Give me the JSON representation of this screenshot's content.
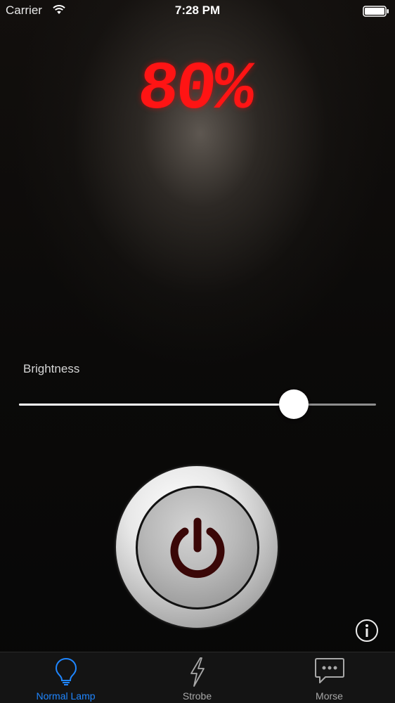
{
  "status_bar": {
    "carrier": "Carrier",
    "time": "7:28 PM",
    "wifi_icon": "wifi-icon",
    "battery_icon": "battery-icon"
  },
  "display": {
    "percent_text": "80%",
    "color": "#ff1414"
  },
  "brightness": {
    "label": "Brightness",
    "value": 0.77
  },
  "power_button": {
    "icon": "power-icon",
    "icon_color": "#3a0707"
  },
  "info_button": {
    "icon": "info-icon"
  },
  "tab_bar": {
    "active_color": "#1f86ff",
    "tabs": [
      {
        "label": "Normal Lamp",
        "icon": "lightbulb-icon",
        "active": true
      },
      {
        "label": "Strobe",
        "icon": "lightning-icon",
        "active": false
      },
      {
        "label": "Morse",
        "icon": "chat-bubble-icon",
        "active": false
      }
    ]
  }
}
